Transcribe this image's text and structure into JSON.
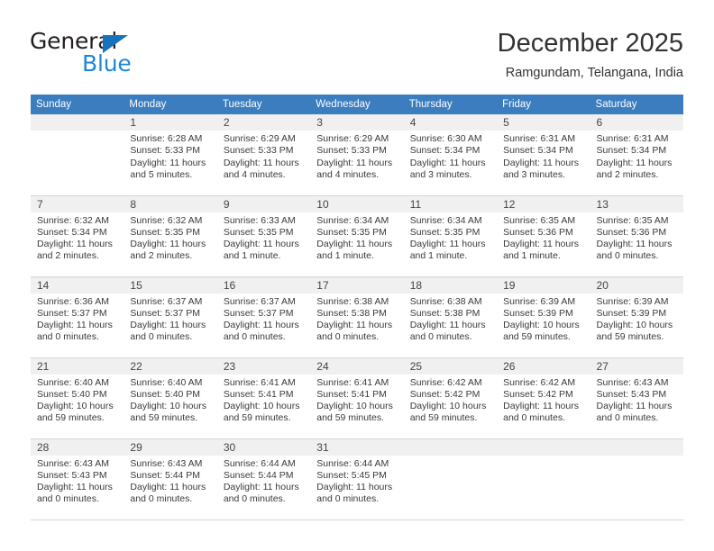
{
  "brand": {
    "name_part1": "General",
    "name_part2": "Blue",
    "triangle_color": "#1673bb",
    "blue_color": "#1f87d8"
  },
  "header": {
    "title": "December 2025",
    "subtitle": "Ramgundam, Telangana, India"
  },
  "theme": {
    "header_row_bg": "#3b7dbf",
    "header_row_text": "#ffffff",
    "daynum_bg": "#f0f0f0",
    "grid_line": "#d4d4d4",
    "body_text": "#333333"
  },
  "weekdays": [
    "Sunday",
    "Monday",
    "Tuesday",
    "Wednesday",
    "Thursday",
    "Friday",
    "Saturday"
  ],
  "labels": {
    "sunrise_prefix": "Sunrise:",
    "sunset_prefix": "Sunset:",
    "daylight_prefix": "Daylight:"
  },
  "weeks": [
    [
      {
        "day": "",
        "sunrise": "",
        "sunset": "",
        "daylight_line1": "",
        "daylight_line2": ""
      },
      {
        "day": "1",
        "sunrise": "Sunrise: 6:28 AM",
        "sunset": "Sunset: 5:33 PM",
        "daylight_line1": "Daylight: 11 hours",
        "daylight_line2": "and 5 minutes."
      },
      {
        "day": "2",
        "sunrise": "Sunrise: 6:29 AM",
        "sunset": "Sunset: 5:33 PM",
        "daylight_line1": "Daylight: 11 hours",
        "daylight_line2": "and 4 minutes."
      },
      {
        "day": "3",
        "sunrise": "Sunrise: 6:29 AM",
        "sunset": "Sunset: 5:33 PM",
        "daylight_line1": "Daylight: 11 hours",
        "daylight_line2": "and 4 minutes."
      },
      {
        "day": "4",
        "sunrise": "Sunrise: 6:30 AM",
        "sunset": "Sunset: 5:34 PM",
        "daylight_line1": "Daylight: 11 hours",
        "daylight_line2": "and 3 minutes."
      },
      {
        "day": "5",
        "sunrise": "Sunrise: 6:31 AM",
        "sunset": "Sunset: 5:34 PM",
        "daylight_line1": "Daylight: 11 hours",
        "daylight_line2": "and 3 minutes."
      },
      {
        "day": "6",
        "sunrise": "Sunrise: 6:31 AM",
        "sunset": "Sunset: 5:34 PM",
        "daylight_line1": "Daylight: 11 hours",
        "daylight_line2": "and 2 minutes."
      }
    ],
    [
      {
        "day": "7",
        "sunrise": "Sunrise: 6:32 AM",
        "sunset": "Sunset: 5:34 PM",
        "daylight_line1": "Daylight: 11 hours",
        "daylight_line2": "and 2 minutes."
      },
      {
        "day": "8",
        "sunrise": "Sunrise: 6:32 AM",
        "sunset": "Sunset: 5:35 PM",
        "daylight_line1": "Daylight: 11 hours",
        "daylight_line2": "and 2 minutes."
      },
      {
        "day": "9",
        "sunrise": "Sunrise: 6:33 AM",
        "sunset": "Sunset: 5:35 PM",
        "daylight_line1": "Daylight: 11 hours",
        "daylight_line2": "and 1 minute."
      },
      {
        "day": "10",
        "sunrise": "Sunrise: 6:34 AM",
        "sunset": "Sunset: 5:35 PM",
        "daylight_line1": "Daylight: 11 hours",
        "daylight_line2": "and 1 minute."
      },
      {
        "day": "11",
        "sunrise": "Sunrise: 6:34 AM",
        "sunset": "Sunset: 5:35 PM",
        "daylight_line1": "Daylight: 11 hours",
        "daylight_line2": "and 1 minute."
      },
      {
        "day": "12",
        "sunrise": "Sunrise: 6:35 AM",
        "sunset": "Sunset: 5:36 PM",
        "daylight_line1": "Daylight: 11 hours",
        "daylight_line2": "and 1 minute."
      },
      {
        "day": "13",
        "sunrise": "Sunrise: 6:35 AM",
        "sunset": "Sunset: 5:36 PM",
        "daylight_line1": "Daylight: 11 hours",
        "daylight_line2": "and 0 minutes."
      }
    ],
    [
      {
        "day": "14",
        "sunrise": "Sunrise: 6:36 AM",
        "sunset": "Sunset: 5:37 PM",
        "daylight_line1": "Daylight: 11 hours",
        "daylight_line2": "and 0 minutes."
      },
      {
        "day": "15",
        "sunrise": "Sunrise: 6:37 AM",
        "sunset": "Sunset: 5:37 PM",
        "daylight_line1": "Daylight: 11 hours",
        "daylight_line2": "and 0 minutes."
      },
      {
        "day": "16",
        "sunrise": "Sunrise: 6:37 AM",
        "sunset": "Sunset: 5:37 PM",
        "daylight_line1": "Daylight: 11 hours",
        "daylight_line2": "and 0 minutes."
      },
      {
        "day": "17",
        "sunrise": "Sunrise: 6:38 AM",
        "sunset": "Sunset: 5:38 PM",
        "daylight_line1": "Daylight: 11 hours",
        "daylight_line2": "and 0 minutes."
      },
      {
        "day": "18",
        "sunrise": "Sunrise: 6:38 AM",
        "sunset": "Sunset: 5:38 PM",
        "daylight_line1": "Daylight: 11 hours",
        "daylight_line2": "and 0 minutes."
      },
      {
        "day": "19",
        "sunrise": "Sunrise: 6:39 AM",
        "sunset": "Sunset: 5:39 PM",
        "daylight_line1": "Daylight: 10 hours",
        "daylight_line2": "and 59 minutes."
      },
      {
        "day": "20",
        "sunrise": "Sunrise: 6:39 AM",
        "sunset": "Sunset: 5:39 PM",
        "daylight_line1": "Daylight: 10 hours",
        "daylight_line2": "and 59 minutes."
      }
    ],
    [
      {
        "day": "21",
        "sunrise": "Sunrise: 6:40 AM",
        "sunset": "Sunset: 5:40 PM",
        "daylight_line1": "Daylight: 10 hours",
        "daylight_line2": "and 59 minutes."
      },
      {
        "day": "22",
        "sunrise": "Sunrise: 6:40 AM",
        "sunset": "Sunset: 5:40 PM",
        "daylight_line1": "Daylight: 10 hours",
        "daylight_line2": "and 59 minutes."
      },
      {
        "day": "23",
        "sunrise": "Sunrise: 6:41 AM",
        "sunset": "Sunset: 5:41 PM",
        "daylight_line1": "Daylight: 10 hours",
        "daylight_line2": "and 59 minutes."
      },
      {
        "day": "24",
        "sunrise": "Sunrise: 6:41 AM",
        "sunset": "Sunset: 5:41 PM",
        "daylight_line1": "Daylight: 10 hours",
        "daylight_line2": "and 59 minutes."
      },
      {
        "day": "25",
        "sunrise": "Sunrise: 6:42 AM",
        "sunset": "Sunset: 5:42 PM",
        "daylight_line1": "Daylight: 10 hours",
        "daylight_line2": "and 59 minutes."
      },
      {
        "day": "26",
        "sunrise": "Sunrise: 6:42 AM",
        "sunset": "Sunset: 5:42 PM",
        "daylight_line1": "Daylight: 11 hours",
        "daylight_line2": "and 0 minutes."
      },
      {
        "day": "27",
        "sunrise": "Sunrise: 6:43 AM",
        "sunset": "Sunset: 5:43 PM",
        "daylight_line1": "Daylight: 11 hours",
        "daylight_line2": "and 0 minutes."
      }
    ],
    [
      {
        "day": "28",
        "sunrise": "Sunrise: 6:43 AM",
        "sunset": "Sunset: 5:43 PM",
        "daylight_line1": "Daylight: 11 hours",
        "daylight_line2": "and 0 minutes."
      },
      {
        "day": "29",
        "sunrise": "Sunrise: 6:43 AM",
        "sunset": "Sunset: 5:44 PM",
        "daylight_line1": "Daylight: 11 hours",
        "daylight_line2": "and 0 minutes."
      },
      {
        "day": "30",
        "sunrise": "Sunrise: 6:44 AM",
        "sunset": "Sunset: 5:44 PM",
        "daylight_line1": "Daylight: 11 hours",
        "daylight_line2": "and 0 minutes."
      },
      {
        "day": "31",
        "sunrise": "Sunrise: 6:44 AM",
        "sunset": "Sunset: 5:45 PM",
        "daylight_line1": "Daylight: 11 hours",
        "daylight_line2": "and 0 minutes."
      },
      {
        "day": "",
        "sunrise": "",
        "sunset": "",
        "daylight_line1": "",
        "daylight_line2": ""
      },
      {
        "day": "",
        "sunrise": "",
        "sunset": "",
        "daylight_line1": "",
        "daylight_line2": ""
      },
      {
        "day": "",
        "sunrise": "",
        "sunset": "",
        "daylight_line1": "",
        "daylight_line2": ""
      }
    ]
  ]
}
